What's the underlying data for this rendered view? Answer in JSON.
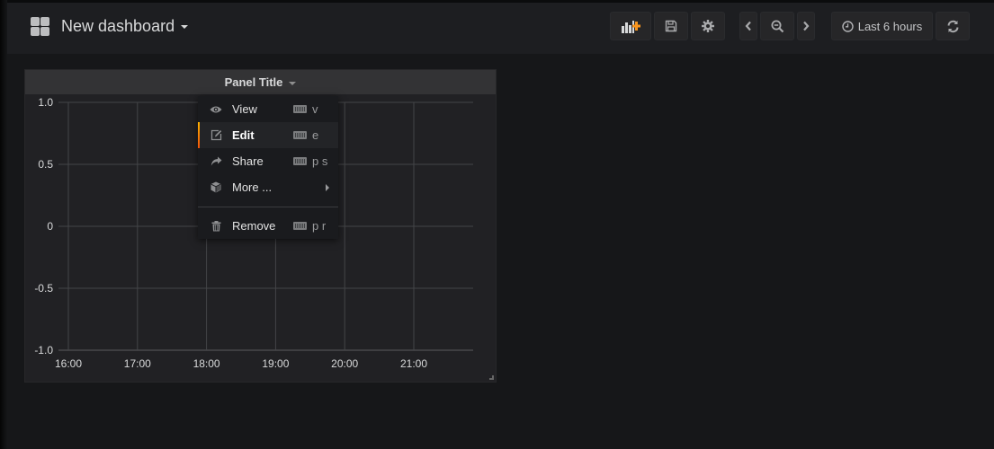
{
  "navbar": {
    "dashboard_title": "New dashboard",
    "buttons": {
      "add_panel": {
        "icon": "add-panel-icon",
        "accent": "#f7941d"
      },
      "save": {
        "icon": "save-icon"
      },
      "settings": {
        "icon": "gear-icon"
      },
      "time_back": {
        "icon": "chevron-left-icon"
      },
      "zoom_out": {
        "icon": "zoom-out-icon"
      },
      "time_forward": {
        "icon": "chevron-right-icon"
      },
      "time_range": {
        "icon": "clock-icon",
        "label": "Last 6 hours"
      },
      "refresh": {
        "icon": "refresh-icon"
      }
    }
  },
  "panel": {
    "title": "Panel Title",
    "menu": {
      "items": [
        {
          "label": "View",
          "icon": "eye-icon",
          "shortcut": "v",
          "active": false
        },
        {
          "label": "Edit",
          "icon": "edit-icon",
          "shortcut": "e",
          "active": true
        },
        {
          "label": "Share",
          "icon": "share-icon",
          "shortcut": "p s",
          "active": false
        },
        {
          "label": "More ...",
          "icon": "cube-icon",
          "submenu": true,
          "active": false
        }
      ],
      "remove": {
        "label": "Remove",
        "icon": "trash-icon",
        "shortcut": "p r"
      }
    }
  },
  "colors": {
    "accent_orange": "#f7941d",
    "active_bar_top": "#ffb300",
    "active_bar_bottom": "#f2530a"
  },
  "chart_data": {
    "type": "line",
    "title": "Panel Title",
    "xlabel": "",
    "ylabel": "",
    "x_ticks": [
      "16:00",
      "17:00",
      "18:00",
      "19:00",
      "20:00",
      "21:00"
    ],
    "y_ticks": [
      "1.0",
      "0.5",
      "0",
      "-0.5",
      "-1.0"
    ],
    "y_tick_values": [
      1.0,
      0.5,
      0,
      -0.5,
      -1.0
    ],
    "ylim": [
      -1.0,
      1.0
    ],
    "xlim": [
      "~15:50",
      "~21:50"
    ],
    "grid": true,
    "series": []
  }
}
